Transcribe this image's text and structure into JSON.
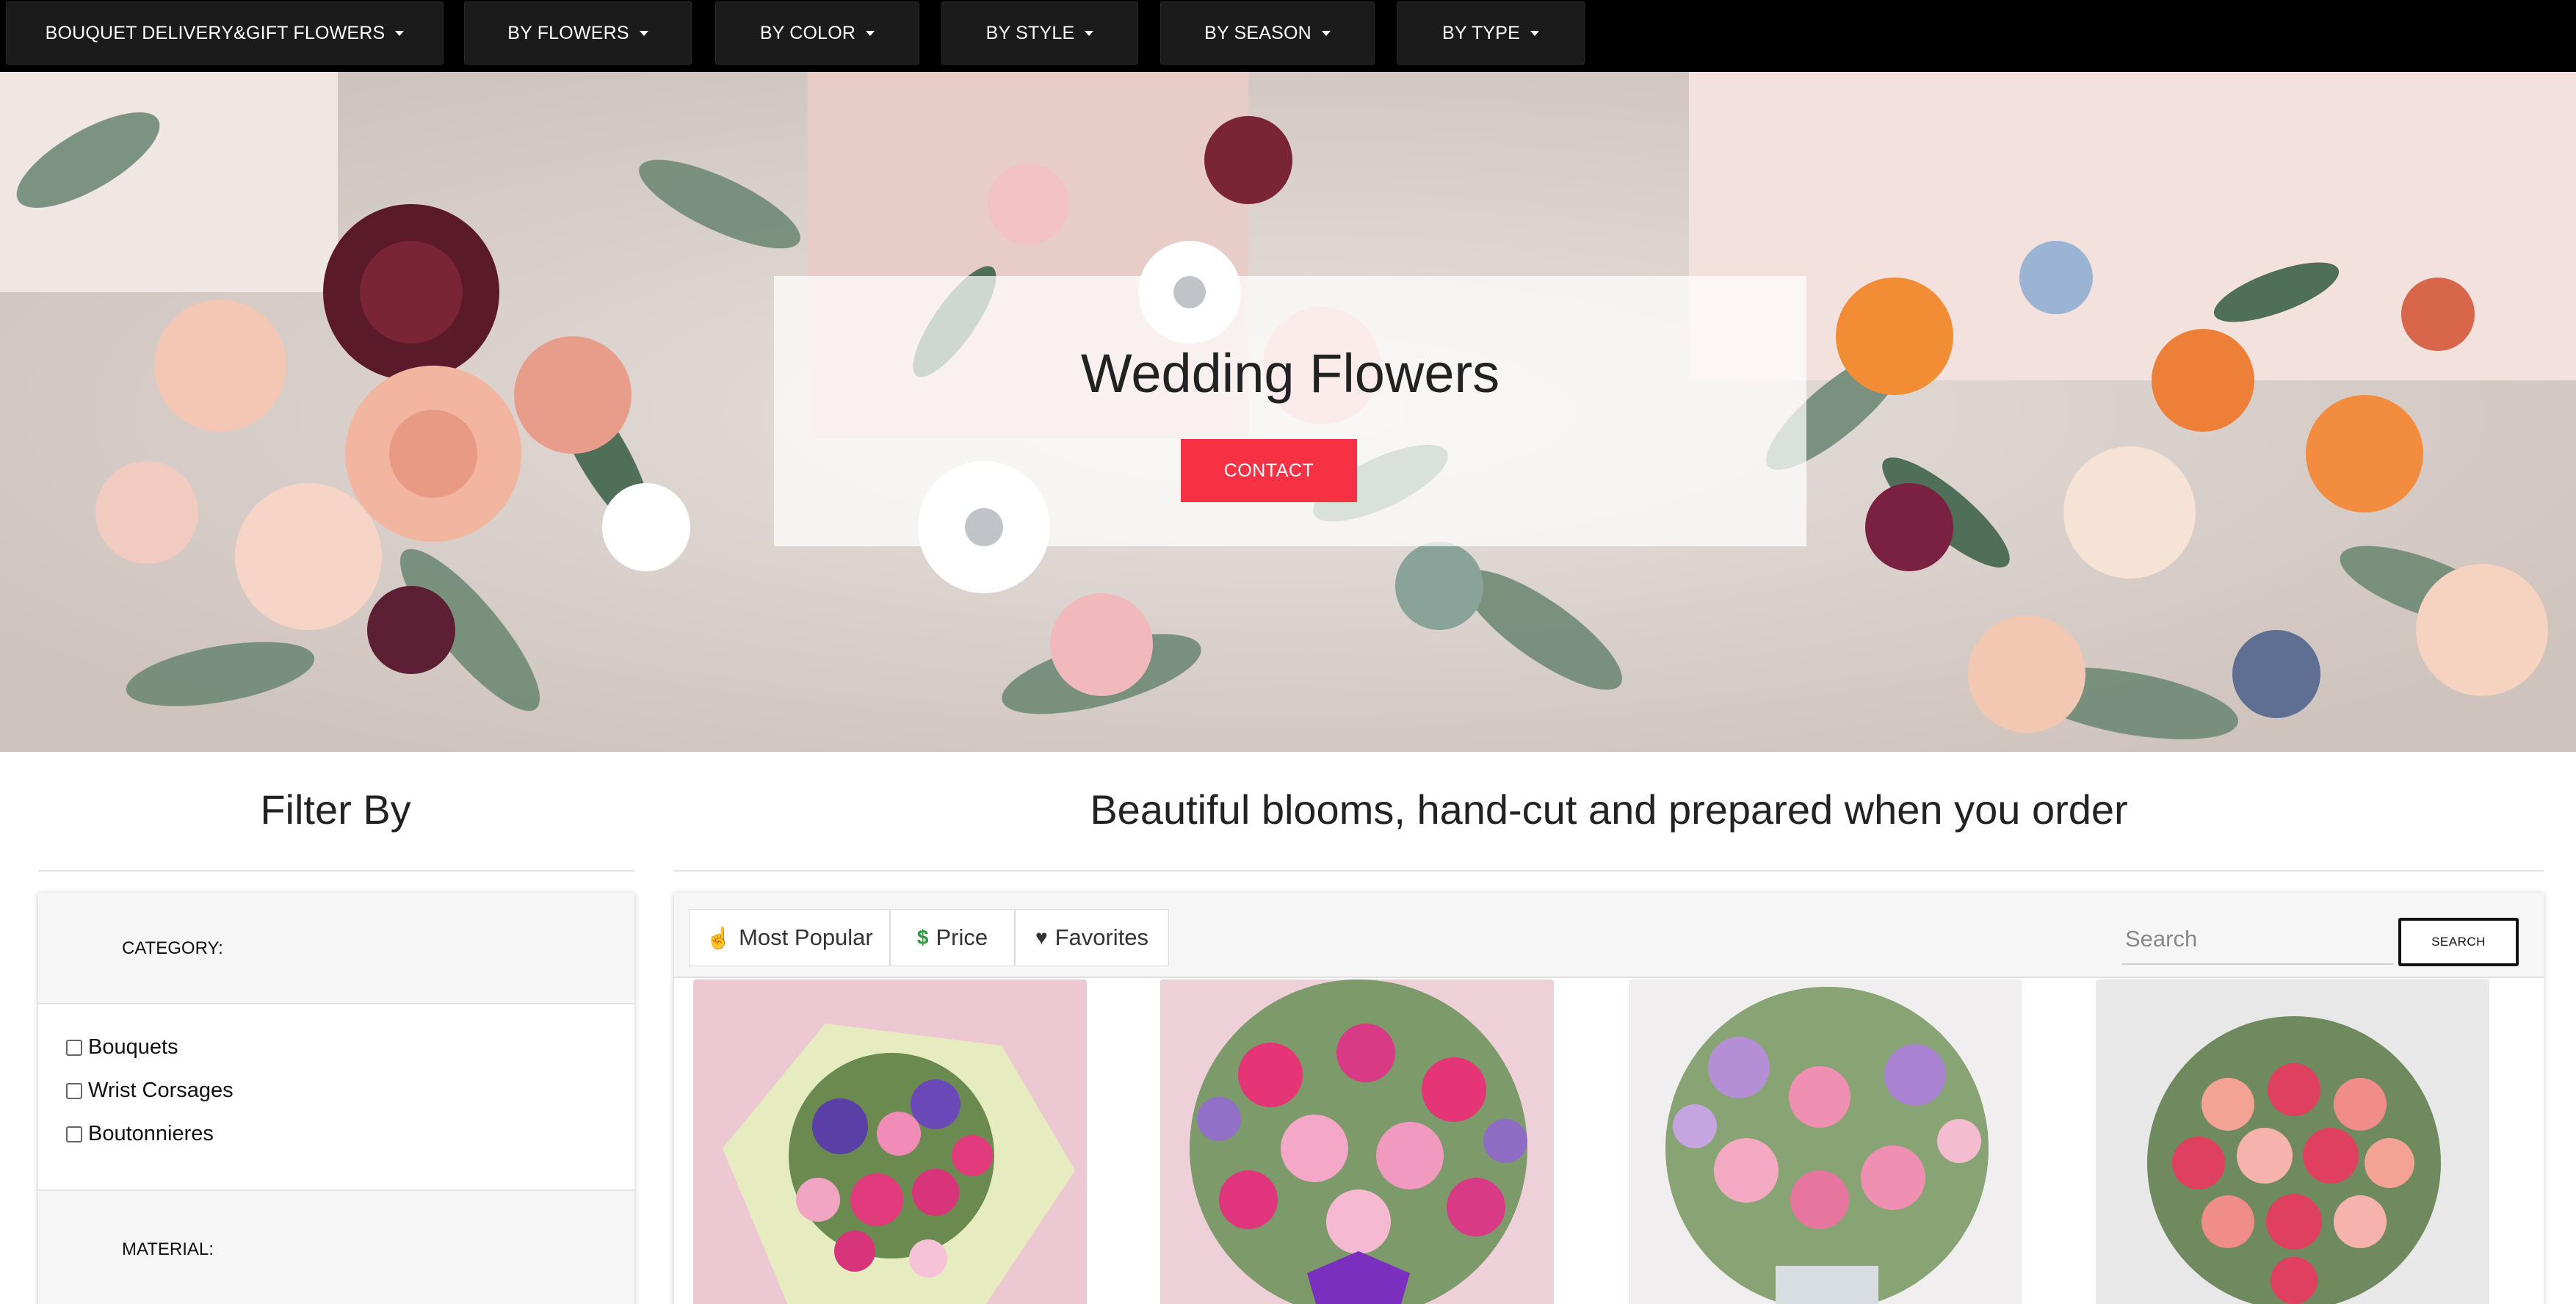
{
  "nav": {
    "items": [
      {
        "label": "BOUQUET DELIVERY&GIFT FLOWERS"
      },
      {
        "label": "BY FLOWERS"
      },
      {
        "label": "BY COLOR"
      },
      {
        "label": "BY STYLE"
      },
      {
        "label": "BY SEASON"
      },
      {
        "label": "BY TYPE"
      }
    ]
  },
  "hero": {
    "title": "Wedding Flowers",
    "contact_label": "CONTACT"
  },
  "filter": {
    "title": "Filter By",
    "category_label": "CATEGORY:",
    "category_options": [
      "Bouquets",
      "Wrist Corsages",
      "Boutonnieres"
    ],
    "material_label": "MATERIAL:"
  },
  "products": {
    "title": "Beautiful blooms, hand-cut and prepared when you order",
    "sort_tabs": [
      {
        "label": "Most Popular",
        "icon": "thumbs-up-icon"
      },
      {
        "label": "Price",
        "icon": "dollar-icon"
      },
      {
        "label": "Favorites",
        "icon": "heart-icon"
      }
    ],
    "search_placeholder": "Search",
    "search_button": "SEARCH",
    "cards": [
      {
        "image": "bouquet-wrapped-purple-pink"
      },
      {
        "image": "bouquet-pink-lily-purple-bow"
      },
      {
        "image": "bouquet-pink-lavender-vase"
      },
      {
        "image": "bouquet-pink-red-roses"
      }
    ]
  },
  "colors": {
    "nav_bg": "#000000",
    "nav_item_bg": "#1b1b1b",
    "accent": "#f73144",
    "dollar_icon": "#2e9a3e"
  }
}
